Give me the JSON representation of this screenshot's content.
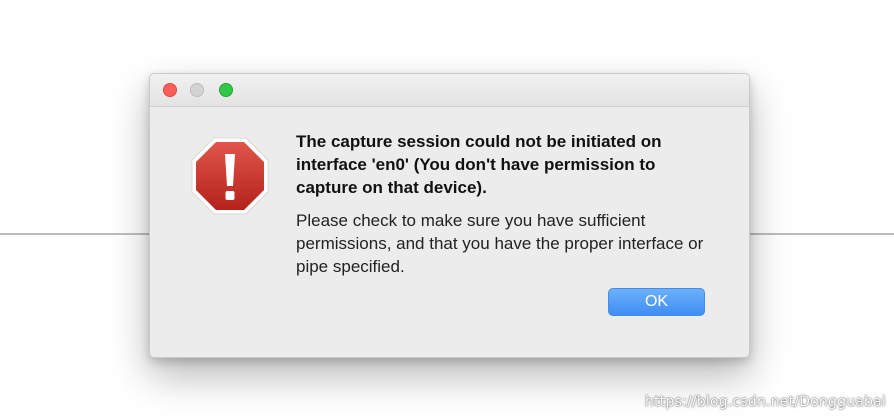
{
  "dialog": {
    "title": "The capture session could not be initiated on interface 'en0' (You don't have permission to capture on that device).",
    "body": "Please check to make sure you have sufficient permissions, and that you have the proper interface or pipe specified.",
    "ok_label": "OK",
    "icon": "stop-sign-alert-icon"
  },
  "window": {
    "controls": [
      "close",
      "minimize",
      "zoom"
    ]
  },
  "watermark": "https://blog.csdn.net/Dongguabai",
  "colors": {
    "close": "#fc5f57",
    "minimize": "#d3d3d3",
    "zoom": "#33c748",
    "ok_button": "#3e8ef5",
    "alert_red": "#c8342b"
  }
}
